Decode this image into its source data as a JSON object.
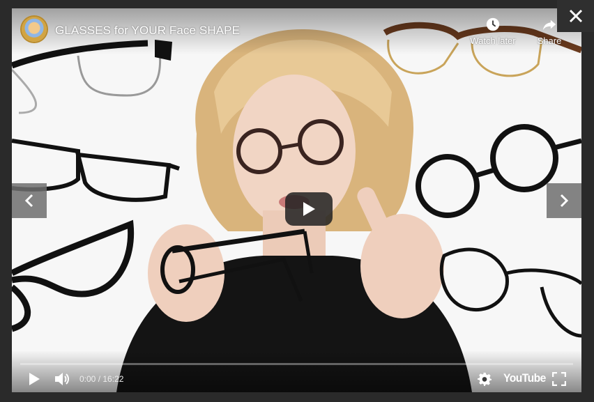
{
  "video": {
    "title": "GLASSES for YOUR Face SHAPE",
    "channel_avatar_icon": "channel-avatar-icon",
    "progress_fraction": 0.0,
    "brand_color": "#ff0000"
  },
  "top_actions": {
    "watch_later_label": "Watch later",
    "share_label": "Share",
    "watch_later_icon": "clock-icon",
    "share_icon": "share-arrow-icon"
  },
  "controls": {
    "time": "0:00 / 16:22",
    "logo_text": "YouTube",
    "play_icon": "play-icon",
    "volume_icon": "volume-icon",
    "settings_icon": "gear-icon",
    "fullscreen_icon": "fullscreen-icon"
  },
  "lightbox": {
    "close_icon": "close-icon",
    "prev_icon": "chevron-left-icon",
    "next_icon": "chevron-right-icon"
  }
}
